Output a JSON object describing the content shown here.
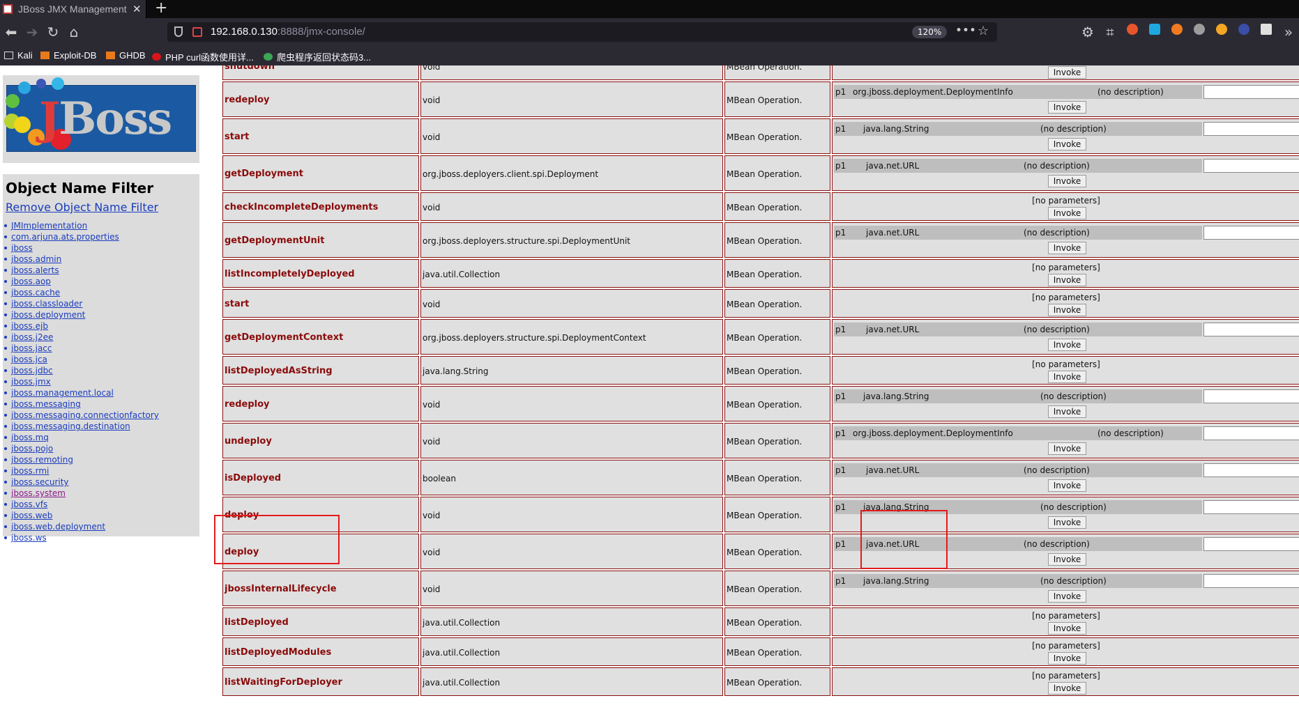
{
  "browser": {
    "tab_title": "JBoss JMX Management Co",
    "new_tab": "+",
    "url_host": "192.168.0.130",
    "url_rest": ":8888/jmx-console/",
    "zoom": "120%",
    "bookmarks": [
      "Kali",
      "Exploit-DB",
      "GHDB",
      "PHP curl函数使用详...",
      "爬虫程序返回状态码3..."
    ]
  },
  "sidebar": {
    "filter_title": "Object Name Filter",
    "remove_link": "Remove Object Name Filter",
    "domains": [
      "JMImplementation",
      "com.arjuna.ats.properties",
      "jboss",
      "jboss.admin",
      "jboss.alerts",
      "jboss.aop",
      "jboss.cache",
      "jboss.classloader",
      "jboss.deployment",
      "jboss.ejb",
      "jboss.j2ee",
      "jboss.jacc",
      "jboss.jca",
      "jboss.jdbc",
      "jboss.jmx",
      "jboss.management.local",
      "jboss.messaging",
      "jboss.messaging.connectionfactory",
      "jboss.messaging.destination",
      "jboss.mq",
      "jboss.pojo",
      "jboss.remoting",
      "jboss.rmi",
      "jboss.security",
      "jboss.system",
      "jboss.vfs",
      "jboss.web",
      "jboss.web.deployment",
      "jboss.ws"
    ],
    "visited_domain": "jboss.system"
  },
  "labels": {
    "description": "MBean Operation.",
    "no_params": "[no parameters]",
    "invoke": "Invoke",
    "no_desc": "(no description)"
  },
  "operations": [
    {
      "name": "shutdown",
      "ret": "void",
      "param": null
    },
    {
      "name": "redeploy",
      "ret": "void",
      "param": {
        "name": "p1",
        "type": "org.jboss.deployment.DeploymentInfo"
      }
    },
    {
      "name": "start",
      "ret": "void",
      "param": {
        "name": "p1",
        "type": "java.lang.String"
      }
    },
    {
      "name": "getDeployment",
      "ret": "org.jboss.deployers.client.spi.Deployment",
      "param": {
        "name": "p1",
        "type": "java.net.URL"
      }
    },
    {
      "name": "checkIncompleteDeployments",
      "ret": "void",
      "param": null
    },
    {
      "name": "getDeploymentUnit",
      "ret": "org.jboss.deployers.structure.spi.DeploymentUnit",
      "param": {
        "name": "p1",
        "type": "java.net.URL"
      }
    },
    {
      "name": "listIncompletelyDeployed",
      "ret": "java.util.Collection",
      "param": null
    },
    {
      "name": "start",
      "ret": "void",
      "param": null
    },
    {
      "name": "getDeploymentContext",
      "ret": "org.jboss.deployers.structure.spi.DeploymentContext",
      "param": {
        "name": "p1",
        "type": "java.net.URL"
      }
    },
    {
      "name": "listDeployedAsString",
      "ret": "java.lang.String",
      "param": null
    },
    {
      "name": "redeploy",
      "ret": "void",
      "param": {
        "name": "p1",
        "type": "java.lang.String"
      }
    },
    {
      "name": "undeploy",
      "ret": "void",
      "param": {
        "name": "p1",
        "type": "org.jboss.deployment.DeploymentInfo"
      }
    },
    {
      "name": "isDeployed",
      "ret": "boolean",
      "param": {
        "name": "p1",
        "type": "java.net.URL"
      }
    },
    {
      "name": "deploy",
      "ret": "void",
      "param": {
        "name": "p1",
        "type": "java.lang.String"
      }
    },
    {
      "name": "deploy",
      "ret": "void",
      "param": {
        "name": "p1",
        "type": "java.net.URL"
      }
    },
    {
      "name": "jbossInternalLifecycle",
      "ret": "void",
      "param": {
        "name": "p1",
        "type": "java.lang.String"
      }
    },
    {
      "name": "listDeployed",
      "ret": "java.util.Collection",
      "param": null
    },
    {
      "name": "listDeployedModules",
      "ret": "java.util.Collection",
      "param": null
    },
    {
      "name": "listWaitingForDeployer",
      "ret": "java.util.Collection",
      "param": null
    }
  ]
}
